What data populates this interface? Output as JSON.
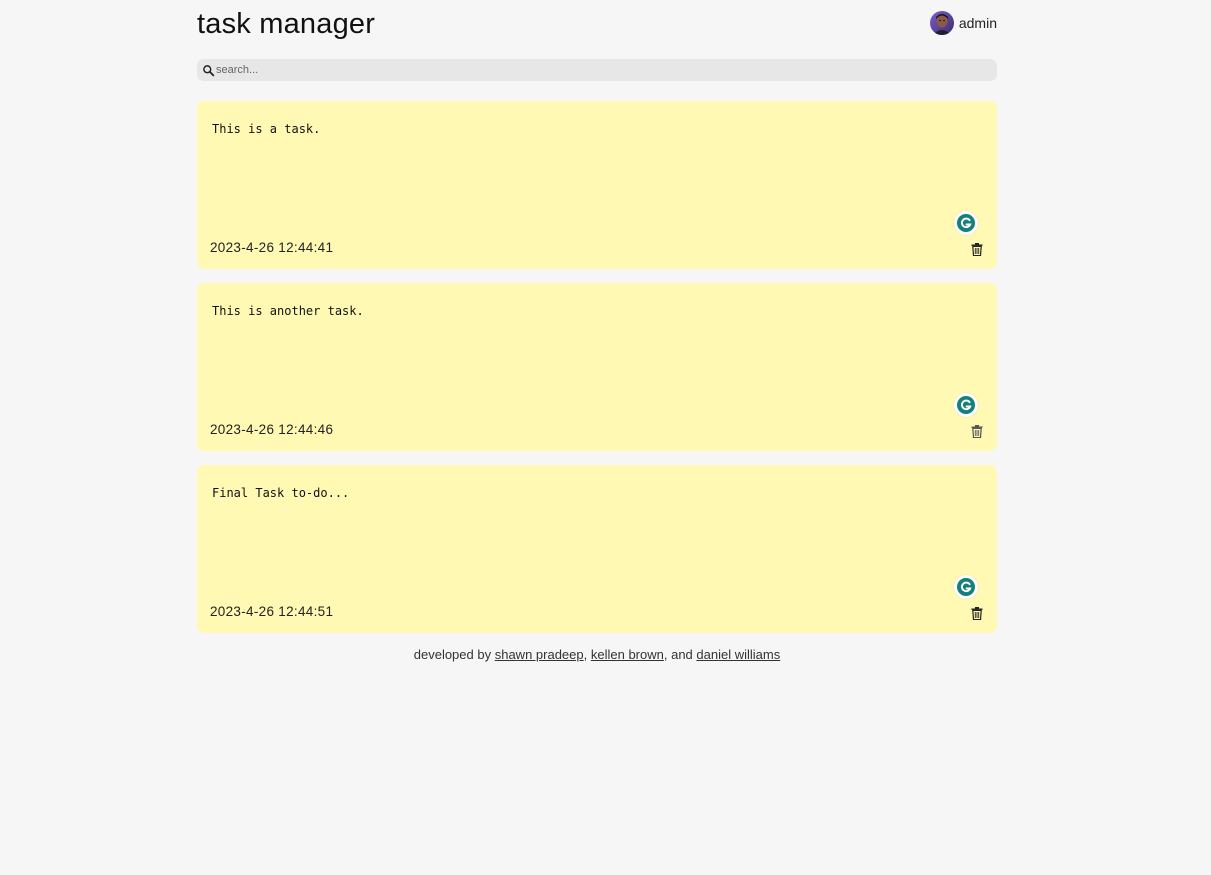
{
  "header": {
    "title": "task manager",
    "username": "admin"
  },
  "search": {
    "placeholder": "search..."
  },
  "notes": [
    {
      "text": "This is a task.",
      "date": "2023-4-26 12:44:41"
    },
    {
      "text": "This is another task.",
      "date": "2023-4-26 12:44:46"
    },
    {
      "text": "Final Task to-do...",
      "date": "2023-4-26 12:44:51"
    }
  ],
  "footer": {
    "prefix": "developed by",
    "sep1": ",",
    "sep2": ", and",
    "dev1": "shawn pradeep",
    "dev2": "kellen brown",
    "dev3": "daniel williams"
  },
  "colors": {
    "background": "#f6f6f6",
    "note": "#fff9b3",
    "search": "#e7e7e7",
    "grammarly": "#15807a"
  },
  "icons": {
    "search": "search-icon",
    "trash": "trash-icon",
    "grammarly": "grammarly-icon",
    "avatar": "avatar"
  }
}
